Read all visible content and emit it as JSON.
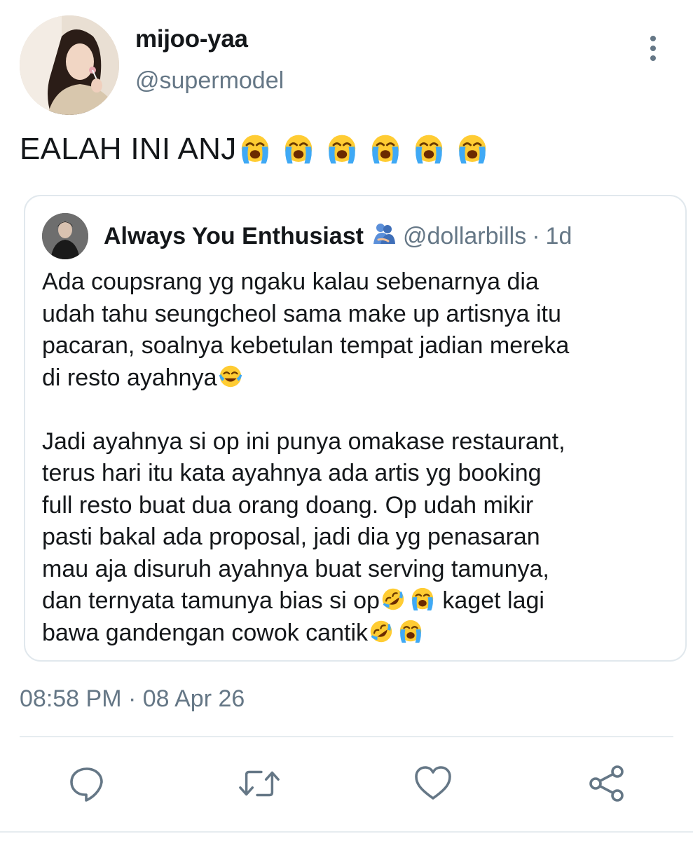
{
  "author": {
    "display_name": "mijoo-yaa",
    "handle": "@supermodel"
  },
  "tweet": {
    "text": "EALAH INI ANJ",
    "emojis": [
      "loudly-crying-face",
      "loudly-crying-face",
      "loudly-crying-face",
      "loudly-crying-face",
      "loudly-crying-face",
      "loudly-crying-face"
    ],
    "timestamp": "08:58 PM · 08 Apr 26"
  },
  "quoted": {
    "display_name": "Always You Enthusiast",
    "name_emoji": "people-hugging",
    "handle": "@dollarbills",
    "separator": "·",
    "time": "1d",
    "lines": [
      "Ada coupsrang yg ngaku kalau sebenarnya dia",
      "udah tahu seungcheol sama make up artisnya itu",
      "pacaran, soalnya kebetulan tempat jadian mereka",
      "di resto ayahnya",
      "Jadi ayahnya si op ini punya omakase restaurant,",
      "terus hari itu kata ayahnya ada artis yg booking",
      "full resto buat dua orang doang. Op udah mikir",
      "pasti bakal ada proposal, jadi dia yg penasaran",
      "mau aja disuruh ayahnya buat serving tamunya,",
      "dan ternyata tamunya bias si op",
      " kaget lagi",
      "bawa gandengan cowok cantik"
    ]
  },
  "actions": {
    "reply": "reply-icon",
    "retweet": "retweet-icon",
    "like": "heart-icon",
    "share": "share-icon"
  },
  "colors": {
    "text": "#14171a",
    "secondary": "#657786",
    "border": "#e1e8ed"
  }
}
